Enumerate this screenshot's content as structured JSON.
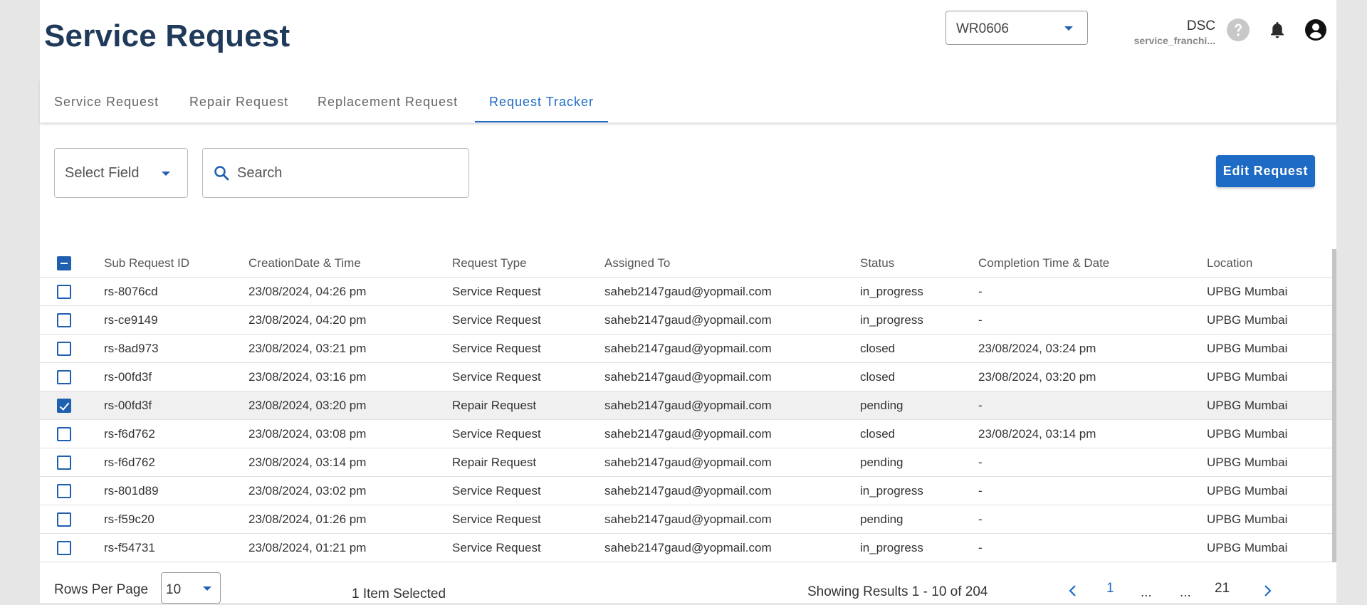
{
  "header": {
    "title": "Service Request",
    "site_select": "WR0606",
    "user_name": "DSC",
    "user_role": "service_franchi..."
  },
  "tabs": [
    {
      "label": "Service Request",
      "active": false
    },
    {
      "label": "Repair Request",
      "active": false
    },
    {
      "label": "Replacement Request",
      "active": false
    },
    {
      "label": "Request Tracker",
      "active": true
    }
  ],
  "filters": {
    "select_field": "Select Field",
    "search_placeholder": "Search",
    "edit_button": "Edit Request"
  },
  "table": {
    "columns": [
      "Sub Request ID",
      "CreationDate & Time",
      "Request Type",
      "Assigned To",
      "Status",
      "Completion Time & Date",
      "Location"
    ],
    "rows": [
      {
        "selected": false,
        "cells": [
          "rs-8076cd",
          "23/08/2024, 04:26 pm",
          "Service Request",
          "saheb2147gaud@yopmail.com",
          "in_progress",
          "-",
          "UPBG Mumbai"
        ]
      },
      {
        "selected": false,
        "cells": [
          "rs-ce9149",
          "23/08/2024, 04:20 pm",
          "Service Request",
          "saheb2147gaud@yopmail.com",
          "in_progress",
          "-",
          "UPBG Mumbai"
        ]
      },
      {
        "selected": false,
        "cells": [
          "rs-8ad973",
          "23/08/2024, 03:21 pm",
          "Service Request",
          "saheb2147gaud@yopmail.com",
          "closed",
          "23/08/2024, 03:24 pm",
          "UPBG Mumbai"
        ]
      },
      {
        "selected": false,
        "cells": [
          "rs-00fd3f",
          "23/08/2024, 03:16 pm",
          "Service Request",
          "saheb2147gaud@yopmail.com",
          "closed",
          "23/08/2024, 03:20 pm",
          "UPBG Mumbai"
        ]
      },
      {
        "selected": true,
        "cells": [
          "rs-00fd3f",
          "23/08/2024, 03:20 pm",
          "Repair Request",
          "saheb2147gaud@yopmail.com",
          "pending",
          "-",
          "UPBG Mumbai"
        ]
      },
      {
        "selected": false,
        "cells": [
          "rs-f6d762",
          "23/08/2024, 03:08 pm",
          "Service Request",
          "saheb2147gaud@yopmail.com",
          "closed",
          "23/08/2024, 03:14 pm",
          "UPBG Mumbai"
        ]
      },
      {
        "selected": false,
        "cells": [
          "rs-f6d762",
          "23/08/2024, 03:14 pm",
          "Repair Request",
          "saheb2147gaud@yopmail.com",
          "pending",
          "-",
          "UPBG Mumbai"
        ]
      },
      {
        "selected": false,
        "cells": [
          "rs-801d89",
          "23/08/2024, 03:02 pm",
          "Service Request",
          "saheb2147gaud@yopmail.com",
          "in_progress",
          "-",
          "UPBG Mumbai"
        ]
      },
      {
        "selected": false,
        "cells": [
          "rs-f59c20",
          "23/08/2024, 01:26 pm",
          "Service Request",
          "saheb2147gaud@yopmail.com",
          "pending",
          "-",
          "UPBG Mumbai"
        ]
      },
      {
        "selected": false,
        "cells": [
          "rs-f54731",
          "23/08/2024, 01:21 pm",
          "Service Request",
          "saheb2147gaud@yopmail.com",
          "in_progress",
          "-",
          "UPBG Mumbai"
        ]
      }
    ]
  },
  "footer": {
    "rows_per_page_label": "Rows Per Page",
    "rows_per_page_value": "10",
    "selected_count": "1 Item Selected",
    "results_text": "Showing Results 1 - 10 of 204",
    "page_current": "1",
    "ellipsis": "...",
    "page_last": "21"
  },
  "colors": {
    "accent": "#1e6bc6",
    "title": "#1f3a5a"
  }
}
